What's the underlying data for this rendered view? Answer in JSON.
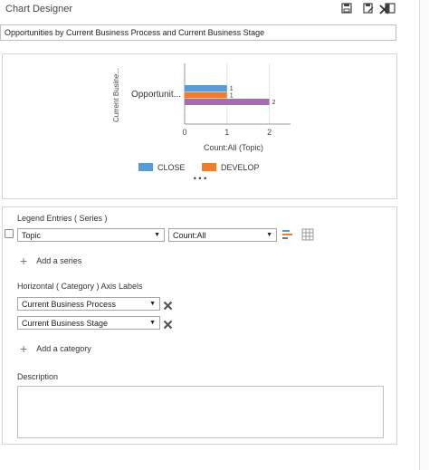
{
  "window": {
    "title": "Chart Designer"
  },
  "toolbar": {
    "icons": [
      "save-icon",
      "save-edit-icon",
      "layout-icon",
      "close-icon"
    ]
  },
  "chart_name": {
    "value": "Opportunities by Current Business Process and Current Business Stage"
  },
  "chart_data": {
    "type": "bar",
    "orientation": "horizontal",
    "categories": [
      "Opportunit..."
    ],
    "series": [
      {
        "name": "CLOSE",
        "values": [
          1
        ],
        "color": "#5b9bd5"
      },
      {
        "name": "DEVELOP",
        "values": [
          1
        ],
        "color": "#ed7d31"
      },
      {
        "name": "",
        "values": [
          2
        ],
        "color": "#a56db0"
      }
    ],
    "xlabel": "Count:All (Topic)",
    "ylabel": "Current Busine...",
    "xlim": [
      0,
      2.5
    ],
    "x_ticks": [
      "0",
      "1",
      "2"
    ],
    "data_labels": [
      "1",
      "1",
      "2"
    ],
    "legend_position": "bottom",
    "legend_more": "• • •"
  },
  "series_section": {
    "label": "Legend Entries ( Series )",
    "field_select": "Topic",
    "aggregate_select": "Count:All",
    "add_label": "Add a series"
  },
  "category_section": {
    "label": "Horizontal ( Category ) Axis Labels",
    "items": [
      "Current Business Process",
      "Current Business Stage"
    ],
    "add_label": "Add a category"
  },
  "description": {
    "label": "Description",
    "value": ""
  }
}
